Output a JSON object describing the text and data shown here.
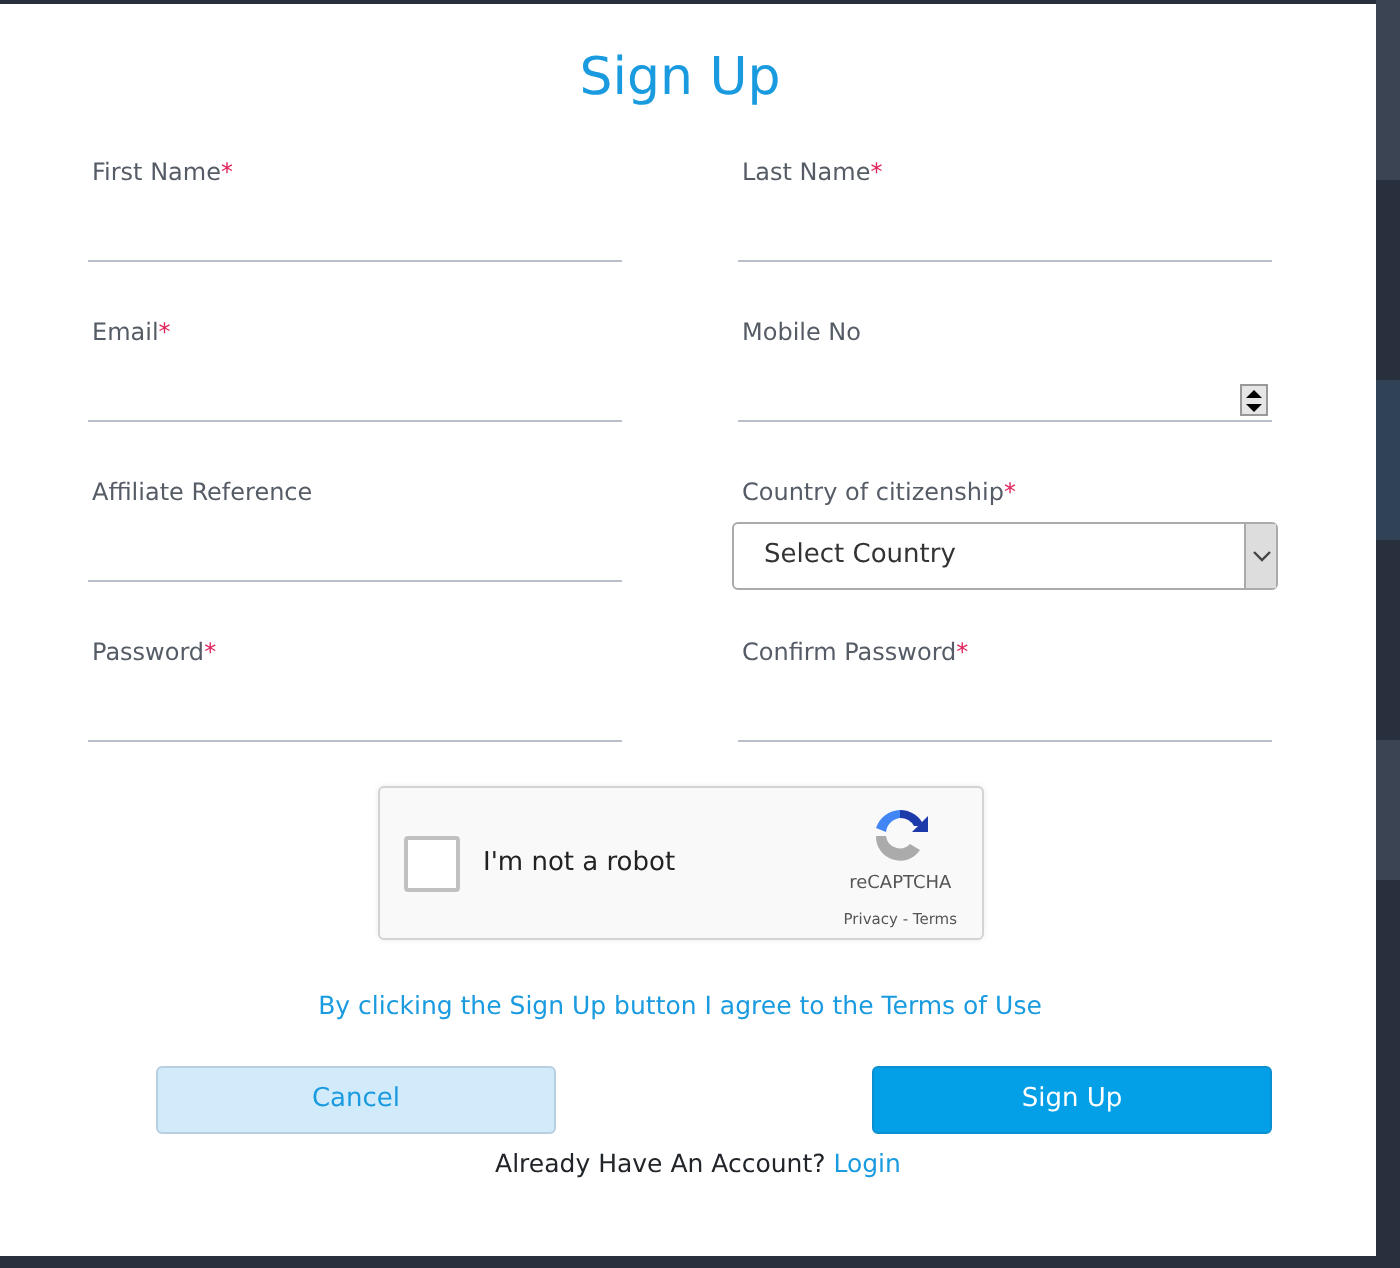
{
  "title": "Sign Up",
  "fields": [
    {
      "label": "First Name",
      "required_mark": "*",
      "kind": "text"
    },
    {
      "label": "Last Name",
      "required_mark": "*",
      "kind": "text"
    },
    {
      "label": "Email",
      "required_mark": "*",
      "kind": "text"
    },
    {
      "label": "Mobile No",
      "kind": "number"
    },
    {
      "label": "Affiliate Reference",
      "kind": "text"
    },
    {
      "label": "Country of citizenship",
      "required_mark": "*",
      "kind": "select",
      "value": "Select Country"
    },
    {
      "label": "Password",
      "required_mark": "*",
      "kind": "text"
    },
    {
      "label": "Confirm Password",
      "required_mark": "*",
      "kind": "text"
    }
  ],
  "captcha": {
    "label": "I'm not a robot",
    "checked": false,
    "brand": "reCAPTCHA",
    "links": "Privacy - Terms"
  },
  "terms": "By clicking the Sign Up button I agree to the Terms of Use",
  "buttons": [
    {
      "label": "Cancel",
      "kind": "secondary"
    },
    {
      "label": "Sign Up",
      "kind": "primary"
    }
  ],
  "footer": {
    "text": "Already Have An Account?",
    "link": "Login"
  }
}
